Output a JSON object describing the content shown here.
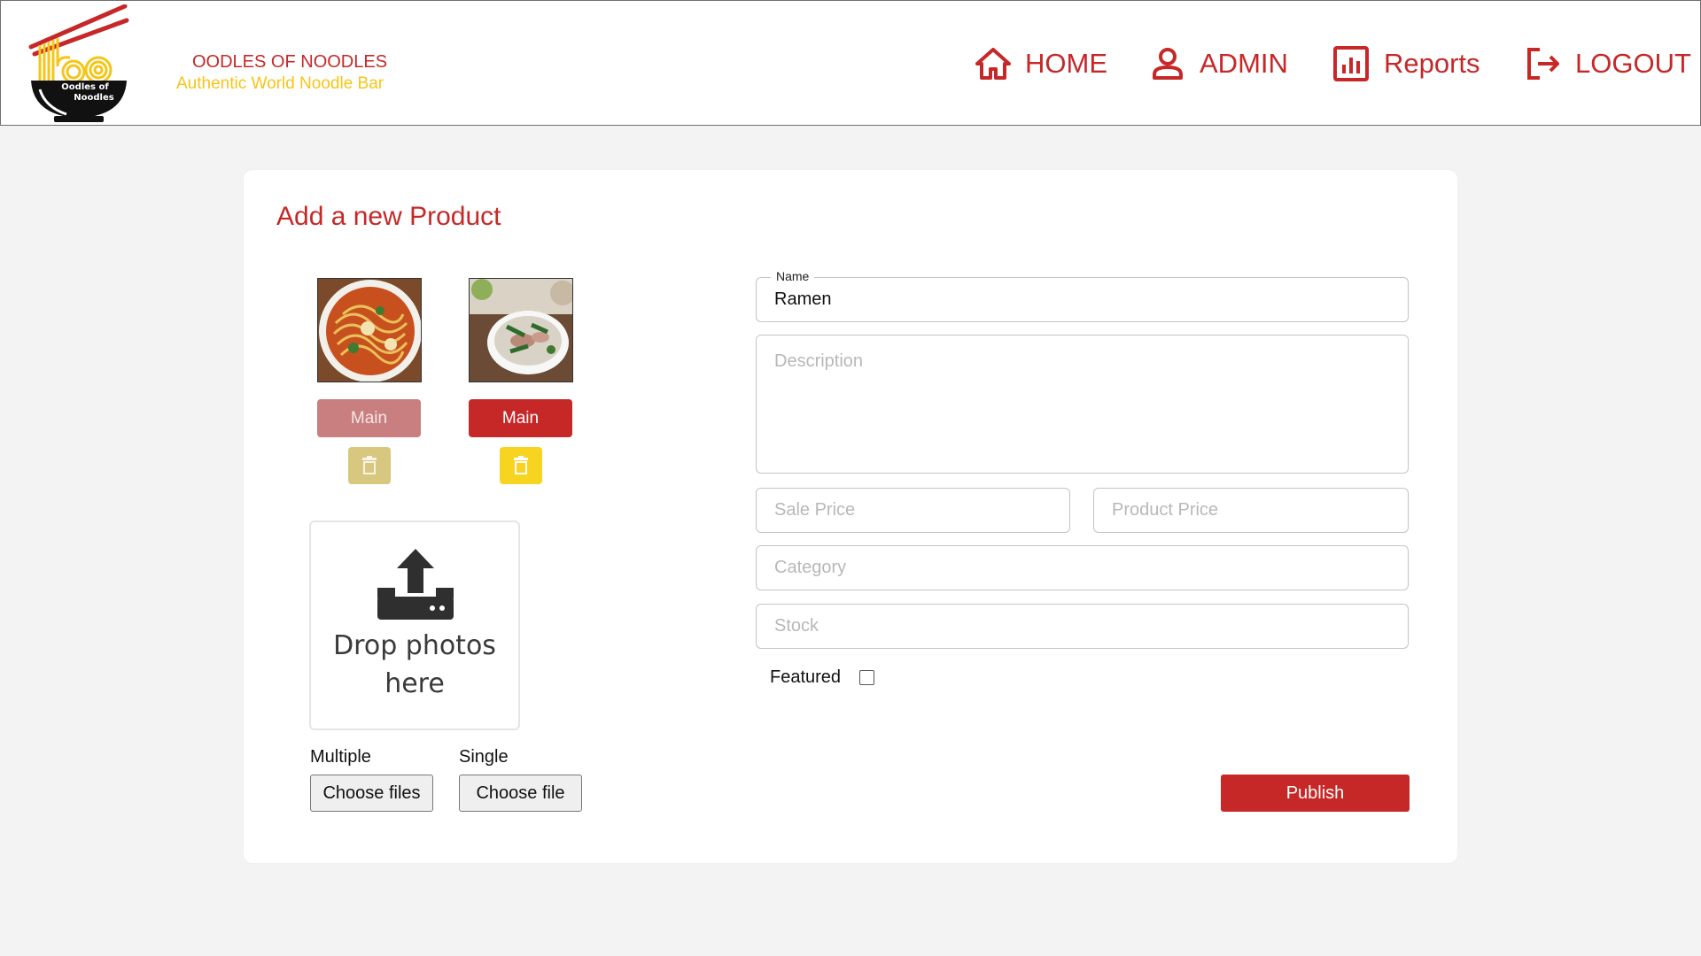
{
  "header": {
    "logo": {
      "text_line1": "Oodles of",
      "text_line2": "Noodles"
    },
    "brand_name": "OODLES OF NOODLES",
    "tagline": "Authentic World Noodle Bar",
    "nav": {
      "home": "HOME",
      "admin": "ADMIN",
      "reports": "Reports",
      "logout": "LOGOUT"
    }
  },
  "form": {
    "title": "Add a new Product",
    "images": [
      {
        "main_label": "Main",
        "is_main": false
      },
      {
        "main_label": "Main",
        "is_main": true
      }
    ],
    "dropzone_text_line1": "Drop photos",
    "dropzone_text_line2": "here",
    "upload": {
      "multiple_label": "Multiple",
      "multiple_button": "Choose files",
      "single_label": "Single",
      "single_button": "Choose file"
    },
    "fields": {
      "name_label": "Name",
      "name_value": "Ramen",
      "description_placeholder": "Description",
      "sale_price_placeholder": "Sale Price",
      "product_price_placeholder": "Product Price",
      "category_placeholder": "Category",
      "stock_placeholder": "Stock"
    },
    "featured_label": "Featured",
    "featured_checked": false,
    "publish_label": "Publish"
  },
  "colors": {
    "brand_red": "#c62828",
    "brand_yellow": "#f5c518",
    "page_bg": "#f3f3f3"
  }
}
